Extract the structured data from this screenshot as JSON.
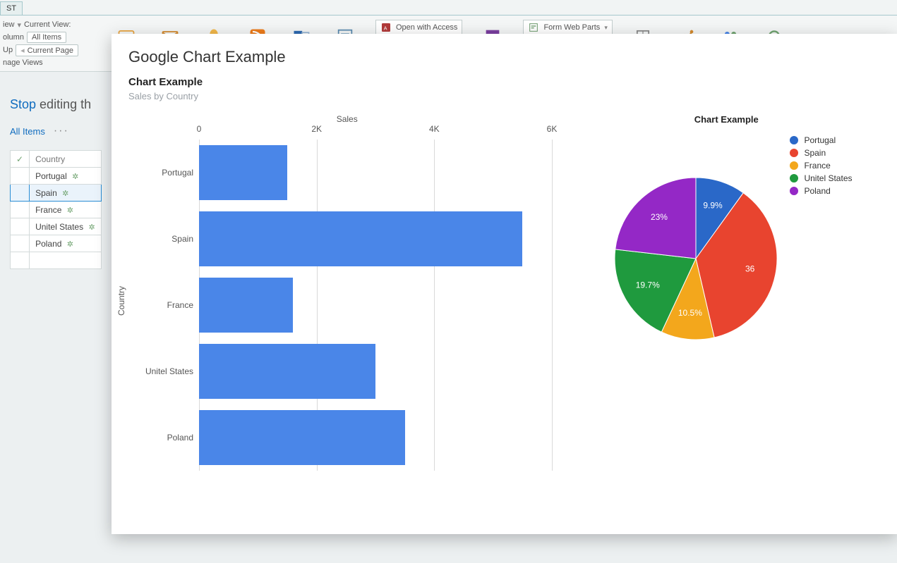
{
  "ribbon": {
    "tab": "ST",
    "view_label": "iew",
    "current_view_label": "Current View:",
    "column_label": "olumn",
    "all_items": "All Items",
    "up_label": "Up",
    "current_page": "Current Page",
    "manage_views": "nage Views",
    "open_access": "Open with Access",
    "form_web_parts": "Form Web Parts"
  },
  "left": {
    "stop": "Stop",
    "editing": "editing th",
    "all_items": "All Items",
    "dots": "···",
    "check": "✓",
    "country_head": "Country",
    "rows": [
      "Portugal",
      "Spain",
      "France",
      "Unitel States",
      "Poland"
    ],
    "selected_index": 1,
    "leaf": "✲"
  },
  "panel": {
    "title": "Google Chart Example",
    "chart_title": "Chart Example",
    "chart_sub": "Sales by Country",
    "bar_xlabel": "Sales",
    "bar_ylabel": "Country",
    "pie_title": "Chart Example"
  },
  "ticks": [
    "0",
    "2K",
    "4K",
    "6K"
  ],
  "colors": {
    "bar": "#4a86e8",
    "pie": [
      "#2a68c8",
      "#e8442f",
      "#f3a71c",
      "#1f9a3e",
      "#9428c6"
    ]
  },
  "pie_labels": [
    "9.9%",
    "36",
    "10.5%",
    "19.7%",
    "23%"
  ],
  "chart_data": [
    {
      "type": "bar",
      "orientation": "horizontal",
      "title": "Chart Example",
      "subtitle": "Sales by Country",
      "xlabel": "Sales",
      "ylabel": "Country",
      "xlim": [
        0,
        6000
      ],
      "categories": [
        "Portugal",
        "Spain",
        "France",
        "Unitel States",
        "Poland"
      ],
      "values": [
        1500,
        5500,
        1600,
        3000,
        3500
      ]
    },
    {
      "type": "pie",
      "title": "Chart Example",
      "categories": [
        "Portugal",
        "Spain",
        "France",
        "Unitel States",
        "Poland"
      ],
      "values": [
        1500,
        5500,
        1600,
        3000,
        3500
      ],
      "percent": [
        9.9,
        36.2,
        10.5,
        19.7,
        23.0
      ],
      "colors": [
        "#2a68c8",
        "#e8442f",
        "#f3a71c",
        "#1f9a3e",
        "#9428c6"
      ]
    }
  ]
}
